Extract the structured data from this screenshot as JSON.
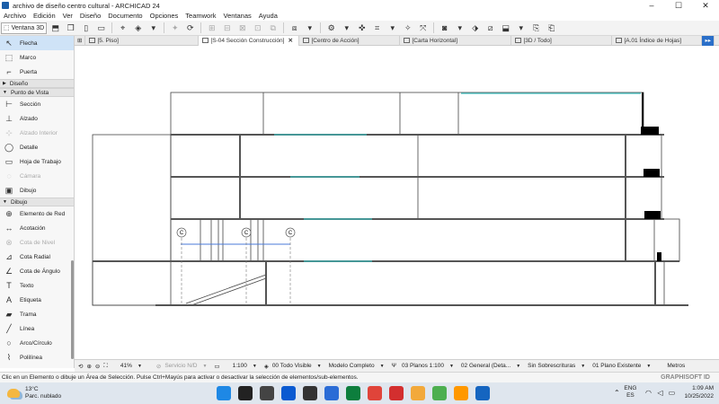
{
  "window": {
    "title": "archivo de diseño centro cultural - ARCHICAD 24",
    "controls": [
      "–",
      "☐",
      "✕"
    ]
  },
  "menu": [
    "Archivo",
    "Edición",
    "Ver",
    "Diseño",
    "Documento",
    "Opciones",
    "Teamwork",
    "Ventanas",
    "Ayuda"
  ],
  "toolbar": {
    "view3d_label": "Ventana 3D"
  },
  "tabs": [
    {
      "label": "[5. Piso]",
      "active": false
    },
    {
      "label": "[S-04 Sección Construcción]",
      "active": true
    },
    {
      "label": "[Centro de Acción]",
      "active": false
    },
    {
      "label": "[Carta Horizontal]",
      "active": false
    },
    {
      "label": "[3D / Todo]",
      "active": false
    },
    {
      "label": "[A.01 Índice de Hojas]",
      "active": false
    }
  ],
  "toolbox": {
    "items_top": [
      {
        "label": "Flecha",
        "icon": "arrow-icon",
        "glyph": "↖",
        "selected": true,
        "dim": false
      },
      {
        "label": "Marco",
        "icon": "marquee-icon",
        "glyph": "⬚",
        "selected": false,
        "dim": false
      },
      {
        "label": "Puerta",
        "icon": "door-icon",
        "glyph": "⌐",
        "selected": false,
        "dim": false
      }
    ],
    "group_design": "Diseño",
    "group_viewpoint": "Punto de Vista",
    "items_viewpoint": [
      {
        "label": "Sección",
        "icon": "section-icon",
        "glyph": "⊢",
        "selected": false,
        "dim": false
      },
      {
        "label": "Alzado",
        "icon": "elevation-icon",
        "glyph": "⊥",
        "selected": false,
        "dim": false
      },
      {
        "label": "Alzado Interior",
        "icon": "interior-elevation-icon",
        "glyph": "⊹",
        "selected": false,
        "dim": true
      },
      {
        "label": "Detalle",
        "icon": "detail-icon",
        "glyph": "◯",
        "selected": false,
        "dim": false
      },
      {
        "label": "Hoja de Trabajo",
        "icon": "worksheet-icon",
        "glyph": "▭",
        "selected": false,
        "dim": false
      },
      {
        "label": "Cámara",
        "icon": "camera-icon",
        "glyph": "◌",
        "selected": false,
        "dim": true
      },
      {
        "label": "Dibujo",
        "icon": "drawing-icon",
        "glyph": "▣",
        "selected": false,
        "dim": false
      }
    ],
    "group_drawing": "Dibujo",
    "items_drawing": [
      {
        "label": "Elemento de Red",
        "icon": "grid-element-icon",
        "glyph": "⊕",
        "selected": false,
        "dim": false
      },
      {
        "label": "Acotación",
        "icon": "dimension-icon",
        "glyph": "↔",
        "selected": false,
        "dim": false
      },
      {
        "label": "Cota de Nivel",
        "icon": "level-dimension-icon",
        "glyph": "⊗",
        "selected": false,
        "dim": true
      },
      {
        "label": "Cota Radial",
        "icon": "radial-dimension-icon",
        "glyph": "⊿",
        "selected": false,
        "dim": false
      },
      {
        "label": "Cota de Ángulo",
        "icon": "angle-dimension-icon",
        "glyph": "∠",
        "selected": false,
        "dim": false
      },
      {
        "label": "Texto",
        "icon": "text-icon",
        "glyph": "T",
        "selected": false,
        "dim": false
      },
      {
        "label": "Etiqueta",
        "icon": "label-icon",
        "glyph": "A",
        "selected": false,
        "dim": false
      },
      {
        "label": "Trama",
        "icon": "fill-icon",
        "glyph": "▰",
        "selected": false,
        "dim": false
      },
      {
        "label": "Línea",
        "icon": "line-icon",
        "glyph": "╱",
        "selected": false,
        "dim": false
      },
      {
        "label": "Arco/Círculo",
        "icon": "arc-icon",
        "glyph": "○",
        "selected": false,
        "dim": false
      },
      {
        "label": "Polilínea",
        "icon": "polyline-icon",
        "glyph": "⌇",
        "selected": false,
        "dim": false
      }
    ]
  },
  "grid_marker": "C",
  "bottombar": {
    "zoom": "41%",
    "service": "Servicio N/D",
    "scale": "1:100",
    "layers": "00 Todo Visible",
    "model": "Modelo Completo",
    "pens": "03 Planos 1:100",
    "mvo": "02 General (Deta...",
    "overrides": "Sin Sobrescrituras",
    "renovation": "01 Plano Existente",
    "units": "Metros"
  },
  "status": {
    "hint": "Clic en un Elemento o dibuje un Área de Selección. Pulse Ctrl+Mayús para activar o desactivar la selección de elementos/sub-elementos.",
    "brand": "GRAPHISOFT ID"
  },
  "taskbar": {
    "temp": "13°C",
    "weather": "Parc. nublado",
    "lang1": "ENG",
    "lang2": "ES",
    "time": "1:09 AM",
    "date": "10/25/2022",
    "icon_colors": [
      "#1e88e5",
      "#222",
      "#444",
      "#0a5ad1",
      "#333",
      "#2a6cd6",
      "#0d7e3d",
      "#e0443a",
      "#d32f2f",
      "#f2a93b",
      "#4caf50",
      "#ff9800",
      "#1565c0"
    ]
  }
}
